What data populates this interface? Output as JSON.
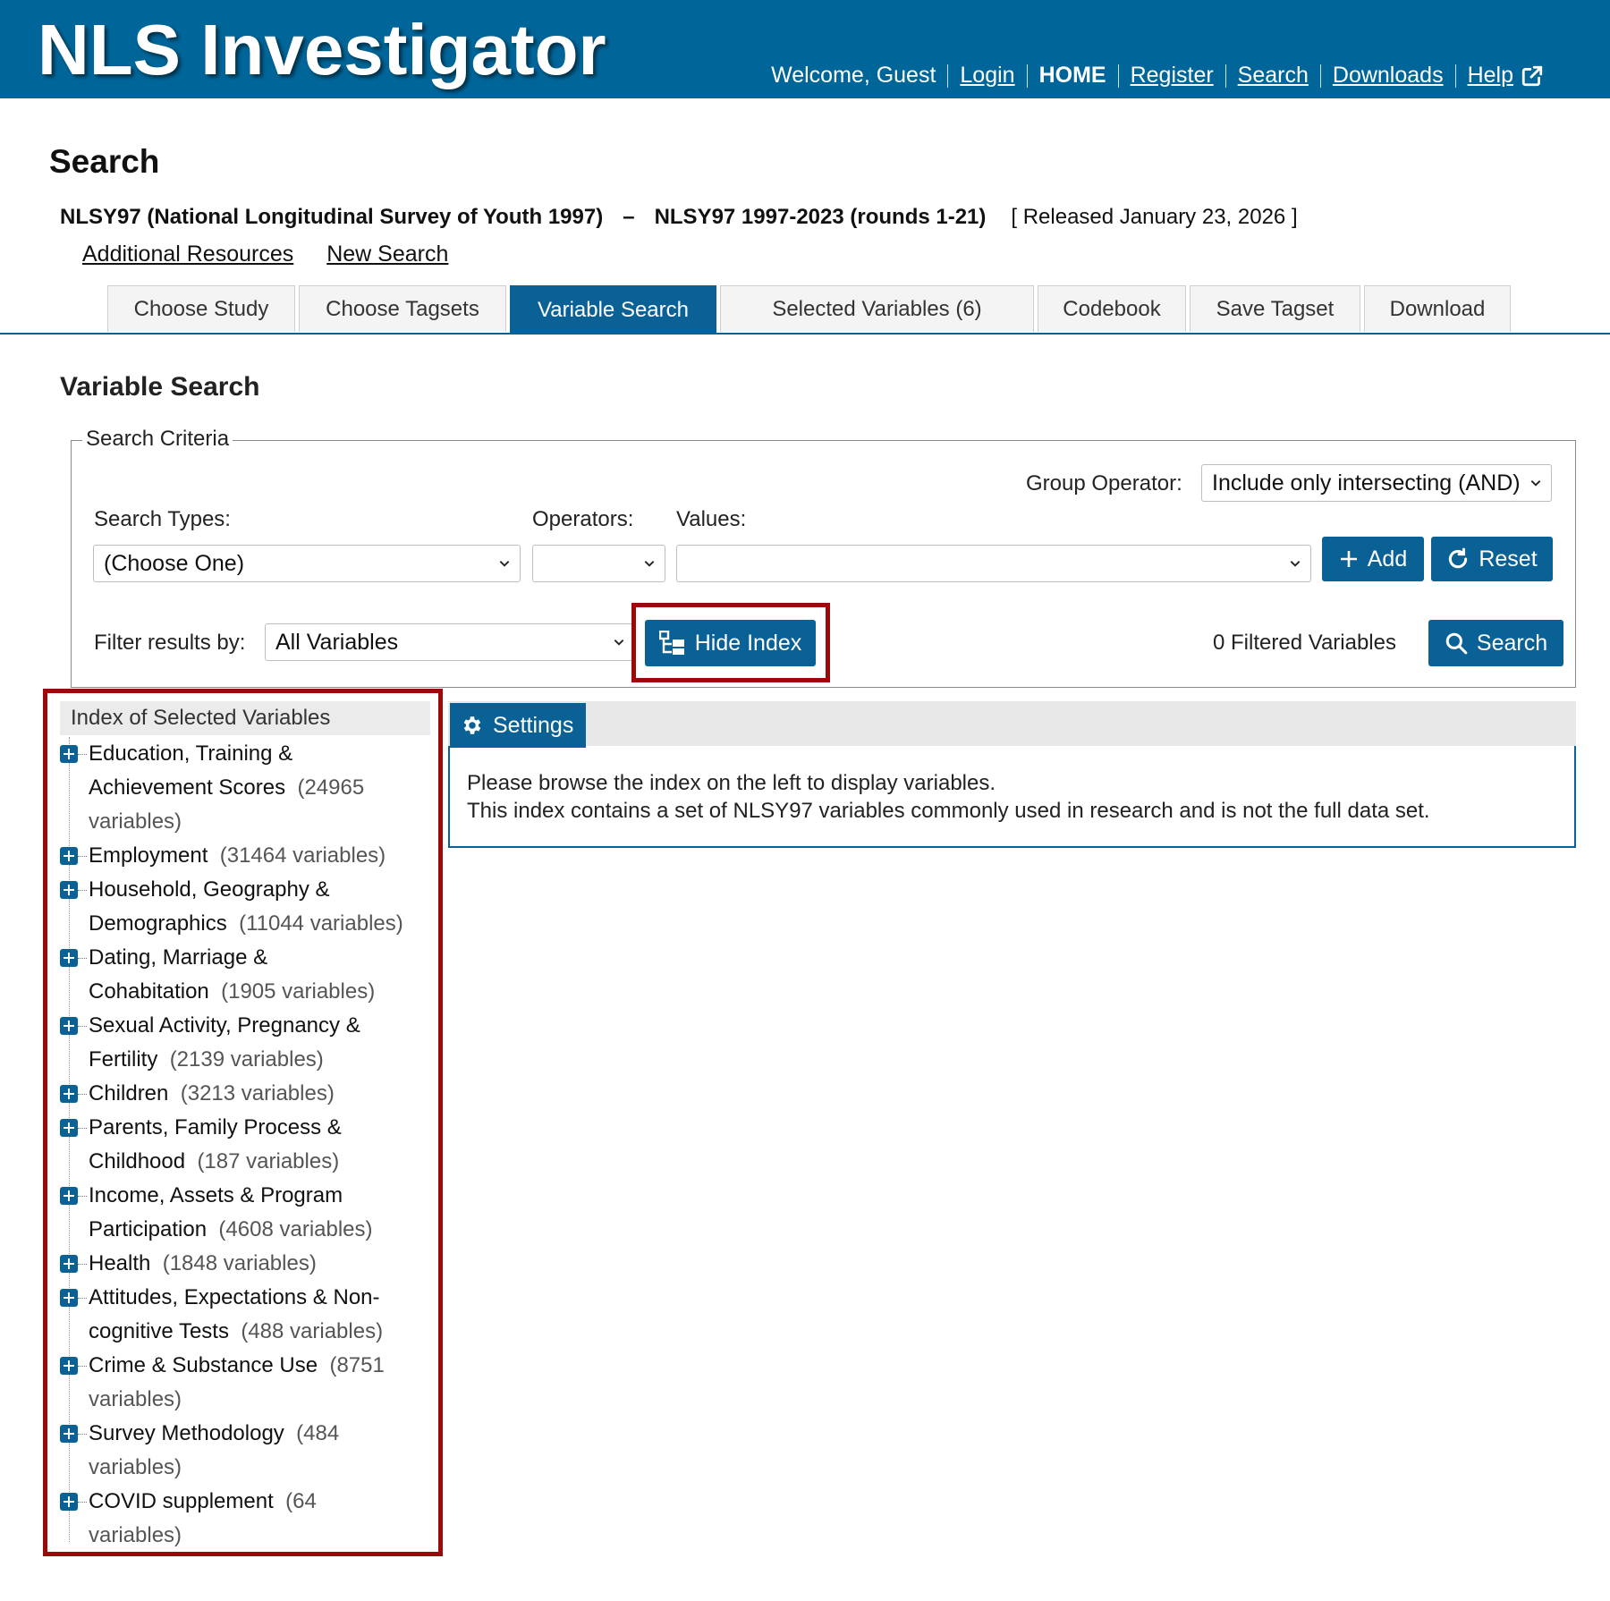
{
  "header": {
    "logo": "NLS Investigator",
    "welcome": "Welcome, Guest",
    "nav": {
      "login": "Login",
      "home": "HOME",
      "register": "Register",
      "search": "Search",
      "downloads": "Downloads",
      "help": "Help"
    }
  },
  "page": {
    "title": "Search"
  },
  "study": {
    "name": "NLSY97 (National Longitudinal Survey of Youth 1997)",
    "dash": "–",
    "release": "NLSY97 1997-2023 (rounds 1-21)",
    "released": "[ Released January 23, 2026 ]"
  },
  "links": {
    "additional": "Additional Resources",
    "new_search": "New Search"
  },
  "tabs": [
    "Choose Study",
    "Choose Tagsets",
    "Variable Search",
    "Selected Variables (6)",
    "Codebook",
    "Save Tagset",
    "Download"
  ],
  "variable_search": {
    "title": "Variable Search",
    "legend": "Search Criteria",
    "group_operator_label": "Group Operator:",
    "group_operator_value": "Include only intersecting (AND)",
    "search_types_label": "Search Types:",
    "search_types_value": "(Choose One)",
    "operators_label": "Operators:",
    "operators_value": "",
    "values_label": "Values:",
    "values_value": "",
    "add_label": "Add",
    "reset_label": "Reset",
    "filter_label": "Filter results by:",
    "filter_value": "All Variables",
    "hide_index_label": "Hide Index",
    "filtered_count": "0 Filtered Variables",
    "search_label": "Search"
  },
  "index": {
    "title": "Index of Selected Variables",
    "items": [
      {
        "line1": "Education, Training &",
        "line2": "Achievement Scores",
        "count": "(24965",
        "count2": "variables)"
      },
      {
        "line1": "Employment",
        "count": "(31464 variables)"
      },
      {
        "line1": "Household, Geography &",
        "line2": "Demographics",
        "count": "(11044 variables)"
      },
      {
        "line1": "Dating, Marriage &",
        "line2": "Cohabitation",
        "count": "(1905 variables)"
      },
      {
        "line1": "Sexual Activity, Pregnancy &",
        "line2": "Fertility",
        "count": "(2139 variables)"
      },
      {
        "line1": "Children",
        "count": "(3213 variables)"
      },
      {
        "line1": "Parents, Family Process &",
        "line2": "Childhood",
        "count": "(187 variables)"
      },
      {
        "line1": "Income, Assets & Program",
        "line2": "Participation",
        "count": "(4608 variables)"
      },
      {
        "line1": "Health",
        "count": "(1848 variables)"
      },
      {
        "line1": "Attitudes, Expectations & Non-",
        "line2": "cognitive Tests",
        "count": "(488 variables)"
      },
      {
        "line1": "Crime & Substance Use",
        "count": "(8751",
        "count2": "variables)"
      },
      {
        "line1": "Survey Methodology",
        "count": "(484",
        "count2": "variables)"
      },
      {
        "line1": "COVID supplement",
        "count": "(64",
        "count2": "variables)"
      }
    ]
  },
  "results": {
    "settings_label": "Settings",
    "message_line1": "Please browse the index on the left to display variables.",
    "message_line2": "This index contains a set of NLSY97 variables commonly used in research and is not the full data set."
  },
  "colors": {
    "header_bg": "#006699",
    "primary": "#0a6196",
    "highlight": "#9b0a0a"
  }
}
